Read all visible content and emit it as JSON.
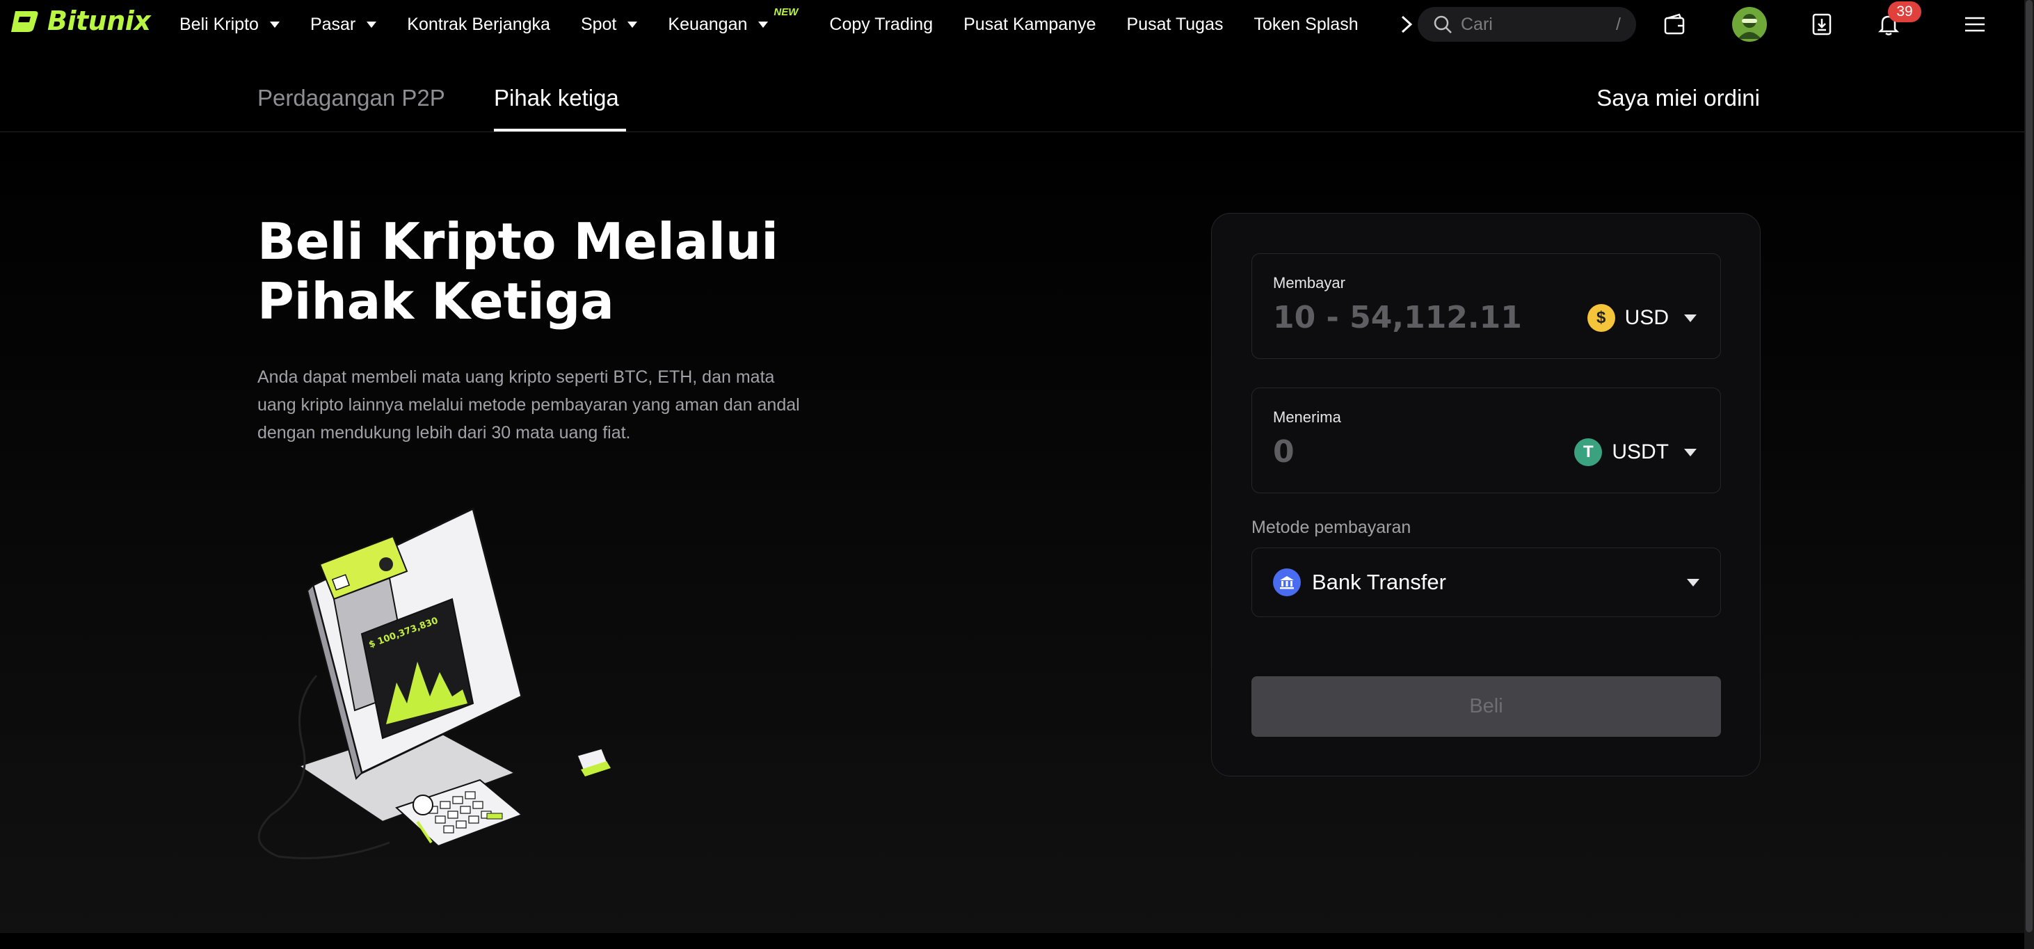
{
  "brand": {
    "name": "Bitunix",
    "accent": "#b9f641"
  },
  "nav": {
    "items": [
      {
        "label": "Beli Kripto",
        "dropdown": true
      },
      {
        "label": "Pasar",
        "dropdown": true
      },
      {
        "label": "Kontrak Berjangka",
        "dropdown": false
      },
      {
        "label": "Spot",
        "dropdown": true
      },
      {
        "label": "Keuangan",
        "dropdown": true,
        "badge": "NEW"
      },
      {
        "label": "Copy Trading",
        "dropdown": false
      },
      {
        "label": "Pusat Kampanye",
        "dropdown": false
      },
      {
        "label": "Pusat Tugas",
        "dropdown": false
      },
      {
        "label": "Token Splash",
        "dropdown": false
      }
    ],
    "search_placeholder": "Cari",
    "search_shortcut": "/",
    "notification_count": "39"
  },
  "subnav": {
    "tabs": [
      {
        "label": "Perdagangan P2P",
        "active": false
      },
      {
        "label": "Pihak ketiga",
        "active": true
      }
    ],
    "orders_link": "Saya miei ordini"
  },
  "hero": {
    "title_line1": "Beli Kripto Melalui",
    "title_line2": "Pihak Ketiga",
    "description": "Anda dapat membeli mata uang kripto seperti BTC, ETH, dan mata uang kripto lainnya melalui metode pembayaran yang aman dan andal dengan mendukung lebih dari 30 mata uang fiat."
  },
  "illustration": {
    "screen_amount": "$ 100,373,830"
  },
  "card": {
    "pay": {
      "label": "Membayar",
      "placeholder": "10 - 54,112.11",
      "currency": "USD",
      "coin_glyph": "$"
    },
    "receive": {
      "label": "Menerima",
      "value": "0",
      "currency": "USDT",
      "coin_glyph": "T"
    },
    "payment_method": {
      "label": "Metode pembayaran",
      "value": "Bank Transfer"
    },
    "buy_button": "Beli"
  }
}
